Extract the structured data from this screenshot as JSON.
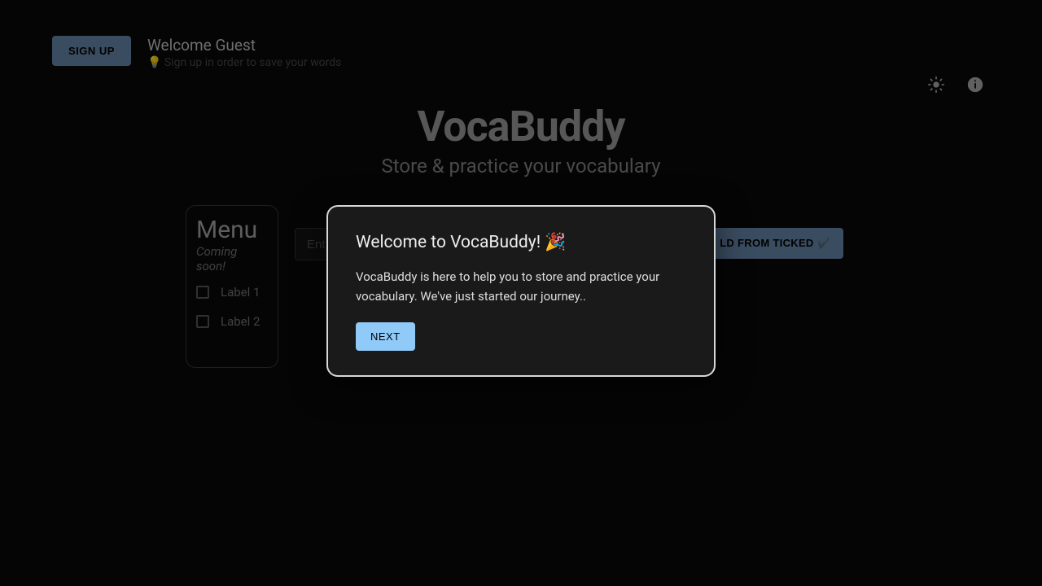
{
  "header": {
    "signup_label": "SIGN UP",
    "welcome_text": "Welcome Guest",
    "hint_text": "💡 Sign up in order to save your words"
  },
  "title": {
    "main": "VocaBuddy",
    "sub": "Store & practice your vocabulary"
  },
  "menu": {
    "title": "Menu",
    "subtitle": "Coming soon!",
    "items": [
      {
        "label": "Label 1"
      },
      {
        "label": "Label 2"
      }
    ]
  },
  "input": {
    "placeholder": "Ent"
  },
  "ticked_button": "LD FROM TICKED ✔️",
  "modal": {
    "title": "Welcome to VocaBuddy! 🎉",
    "body": "VocaBuddy is here to help you to store and practice your vocabulary. We've just started our journey..",
    "next_label": "NEXT"
  }
}
